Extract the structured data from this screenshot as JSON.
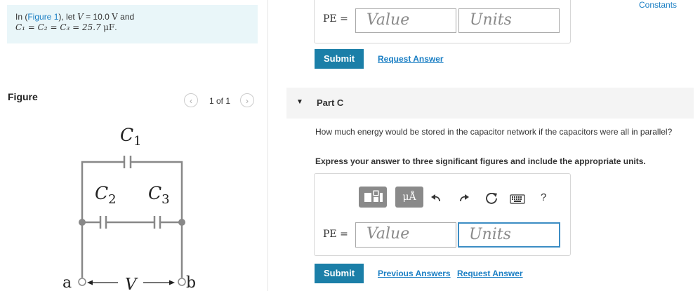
{
  "problem": {
    "prefix": "In (",
    "figure_link": "Figure 1",
    "mid": "), let",
    "var_v": "V",
    "eq": "= 10.0",
    "unit_v": "V",
    "and": "and",
    "line2": "C₁ = C₂ = C₃ = 25.7",
    "unit_c": "μF",
    "period": "."
  },
  "figure": {
    "label": "Figure",
    "prev_icon": "‹",
    "next_icon": "›",
    "page_count": "1 of 1",
    "circuit_labels": {
      "c1": "C",
      "c1_sub": "1",
      "c2": "C",
      "c2_sub": "2",
      "c3": "C",
      "c3_sub": "3",
      "a": "a",
      "b": "b",
      "v": "V"
    }
  },
  "header": {
    "constants": "Constants"
  },
  "part_b": {
    "pe_label": "PE =",
    "value_placeholder": "Value",
    "units_placeholder": "Units",
    "submit": "Submit",
    "request_answer": "Request Answer"
  },
  "part_c": {
    "caret": "▼",
    "title": "Part C",
    "question": "How much energy would be stored in the capacitor network if the capacitors were all in parallel?",
    "instructions": "Express your answer to three significant figures and include the appropriate units.",
    "toolbar": {
      "units_btn_label": "μÅ",
      "help_icon": "?"
    },
    "pe_label": "PE =",
    "value_placeholder": "Value",
    "units_placeholder": "Units",
    "submit": "Submit",
    "previous_answers": "Previous Answers",
    "request_answer": "Request Answer"
  }
}
